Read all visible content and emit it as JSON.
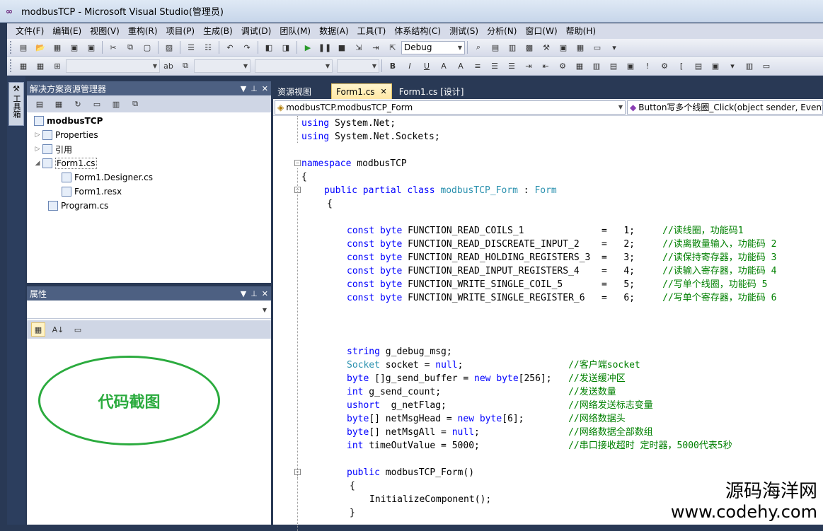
{
  "window": {
    "title": "modbusTCP - Microsoft Visual Studio(管理员)"
  },
  "menu": [
    "文件(F)",
    "编辑(E)",
    "视图(V)",
    "重构(R)",
    "项目(P)",
    "生成(B)",
    "调试(D)",
    "团队(M)",
    "数据(A)",
    "工具(T)",
    "体系结构(C)",
    "测试(S)",
    "分析(N)",
    "窗口(W)",
    "帮助(H)"
  ],
  "toolbar": {
    "config": "Debug"
  },
  "solution_explorer": {
    "title": "解决方案资源管理器",
    "items": [
      {
        "label": "modbusTCP"
      },
      {
        "label": "Properties"
      },
      {
        "label": "引用"
      },
      {
        "label": "Form1.cs"
      },
      {
        "label": "Form1.Designer.cs"
      },
      {
        "label": "Form1.resx"
      },
      {
        "label": "Program.cs"
      }
    ]
  },
  "properties": {
    "title": "属性"
  },
  "annotation": {
    "text": "代码截图"
  },
  "toolbox": {
    "label": "工具箱"
  },
  "tabs": [
    {
      "label": "资源视图"
    },
    {
      "label": "Form1.cs"
    },
    {
      "label": "Form1.cs [设计]"
    }
  ],
  "nav": {
    "class": "modbusTCP.modbusTCP_Form",
    "member": "Button写多个线圈_Click(object sender, EventA"
  },
  "code": [
    "using System.Net;",
    "using System.Net.Sockets;",
    "",
    "namespace modbusTCP",
    "{",
    "public partial class modbusTCP_Form : Form",
    "{",
    "",
    "const byte FUNCTION_READ_COILS_1              =   1;     //读线圈，功能码1",
    "const byte FUNCTION_READ_DISCREATE_INPUT_2    =   2;     //读离散量输入，功能码 2",
    "const byte FUNCTION_READ_HOLDING_REGISTERS_3  =   3;     //读保持寄存器，功能码 3",
    "const byte FUNCTION_READ_INPUT_REGISTERS_4    =   4;     //读输入寄存器，功能码 4",
    "const byte FUNCTION_WRITE_SINGLE_COIL_5       =   5;     //写单个线圈，功能码 5",
    "const byte FUNCTION_WRITE_SINGLE_REGISTER_6   =   6;     //写单个寄存器，功能码 6",
    "",
    "",
    "",
    "string g_debug_msg;",
    "Socket socket = null;                   //客户端socket",
    "byte []g_send_buffer = new byte[256];   //发送缓冲区",
    "int g_send_count;                       //发送数量",
    "ushort  g_netFlag;                      //网络发送标志变量",
    "byte[] netMsgHead = new byte[6];        //网络数据头",
    "byte[] netMsgAll = null;                //网络数据全部数组",
    "int timeOutValue = 5000;                //串口接收超时 定时器，5000代表5秒",
    "",
    "public modbusTCP_Form()",
    "{",
    "InitializeComponent();",
    "}"
  ],
  "watermark": {
    "line1": "源码海洋网",
    "line2": "www.codehy.com"
  }
}
